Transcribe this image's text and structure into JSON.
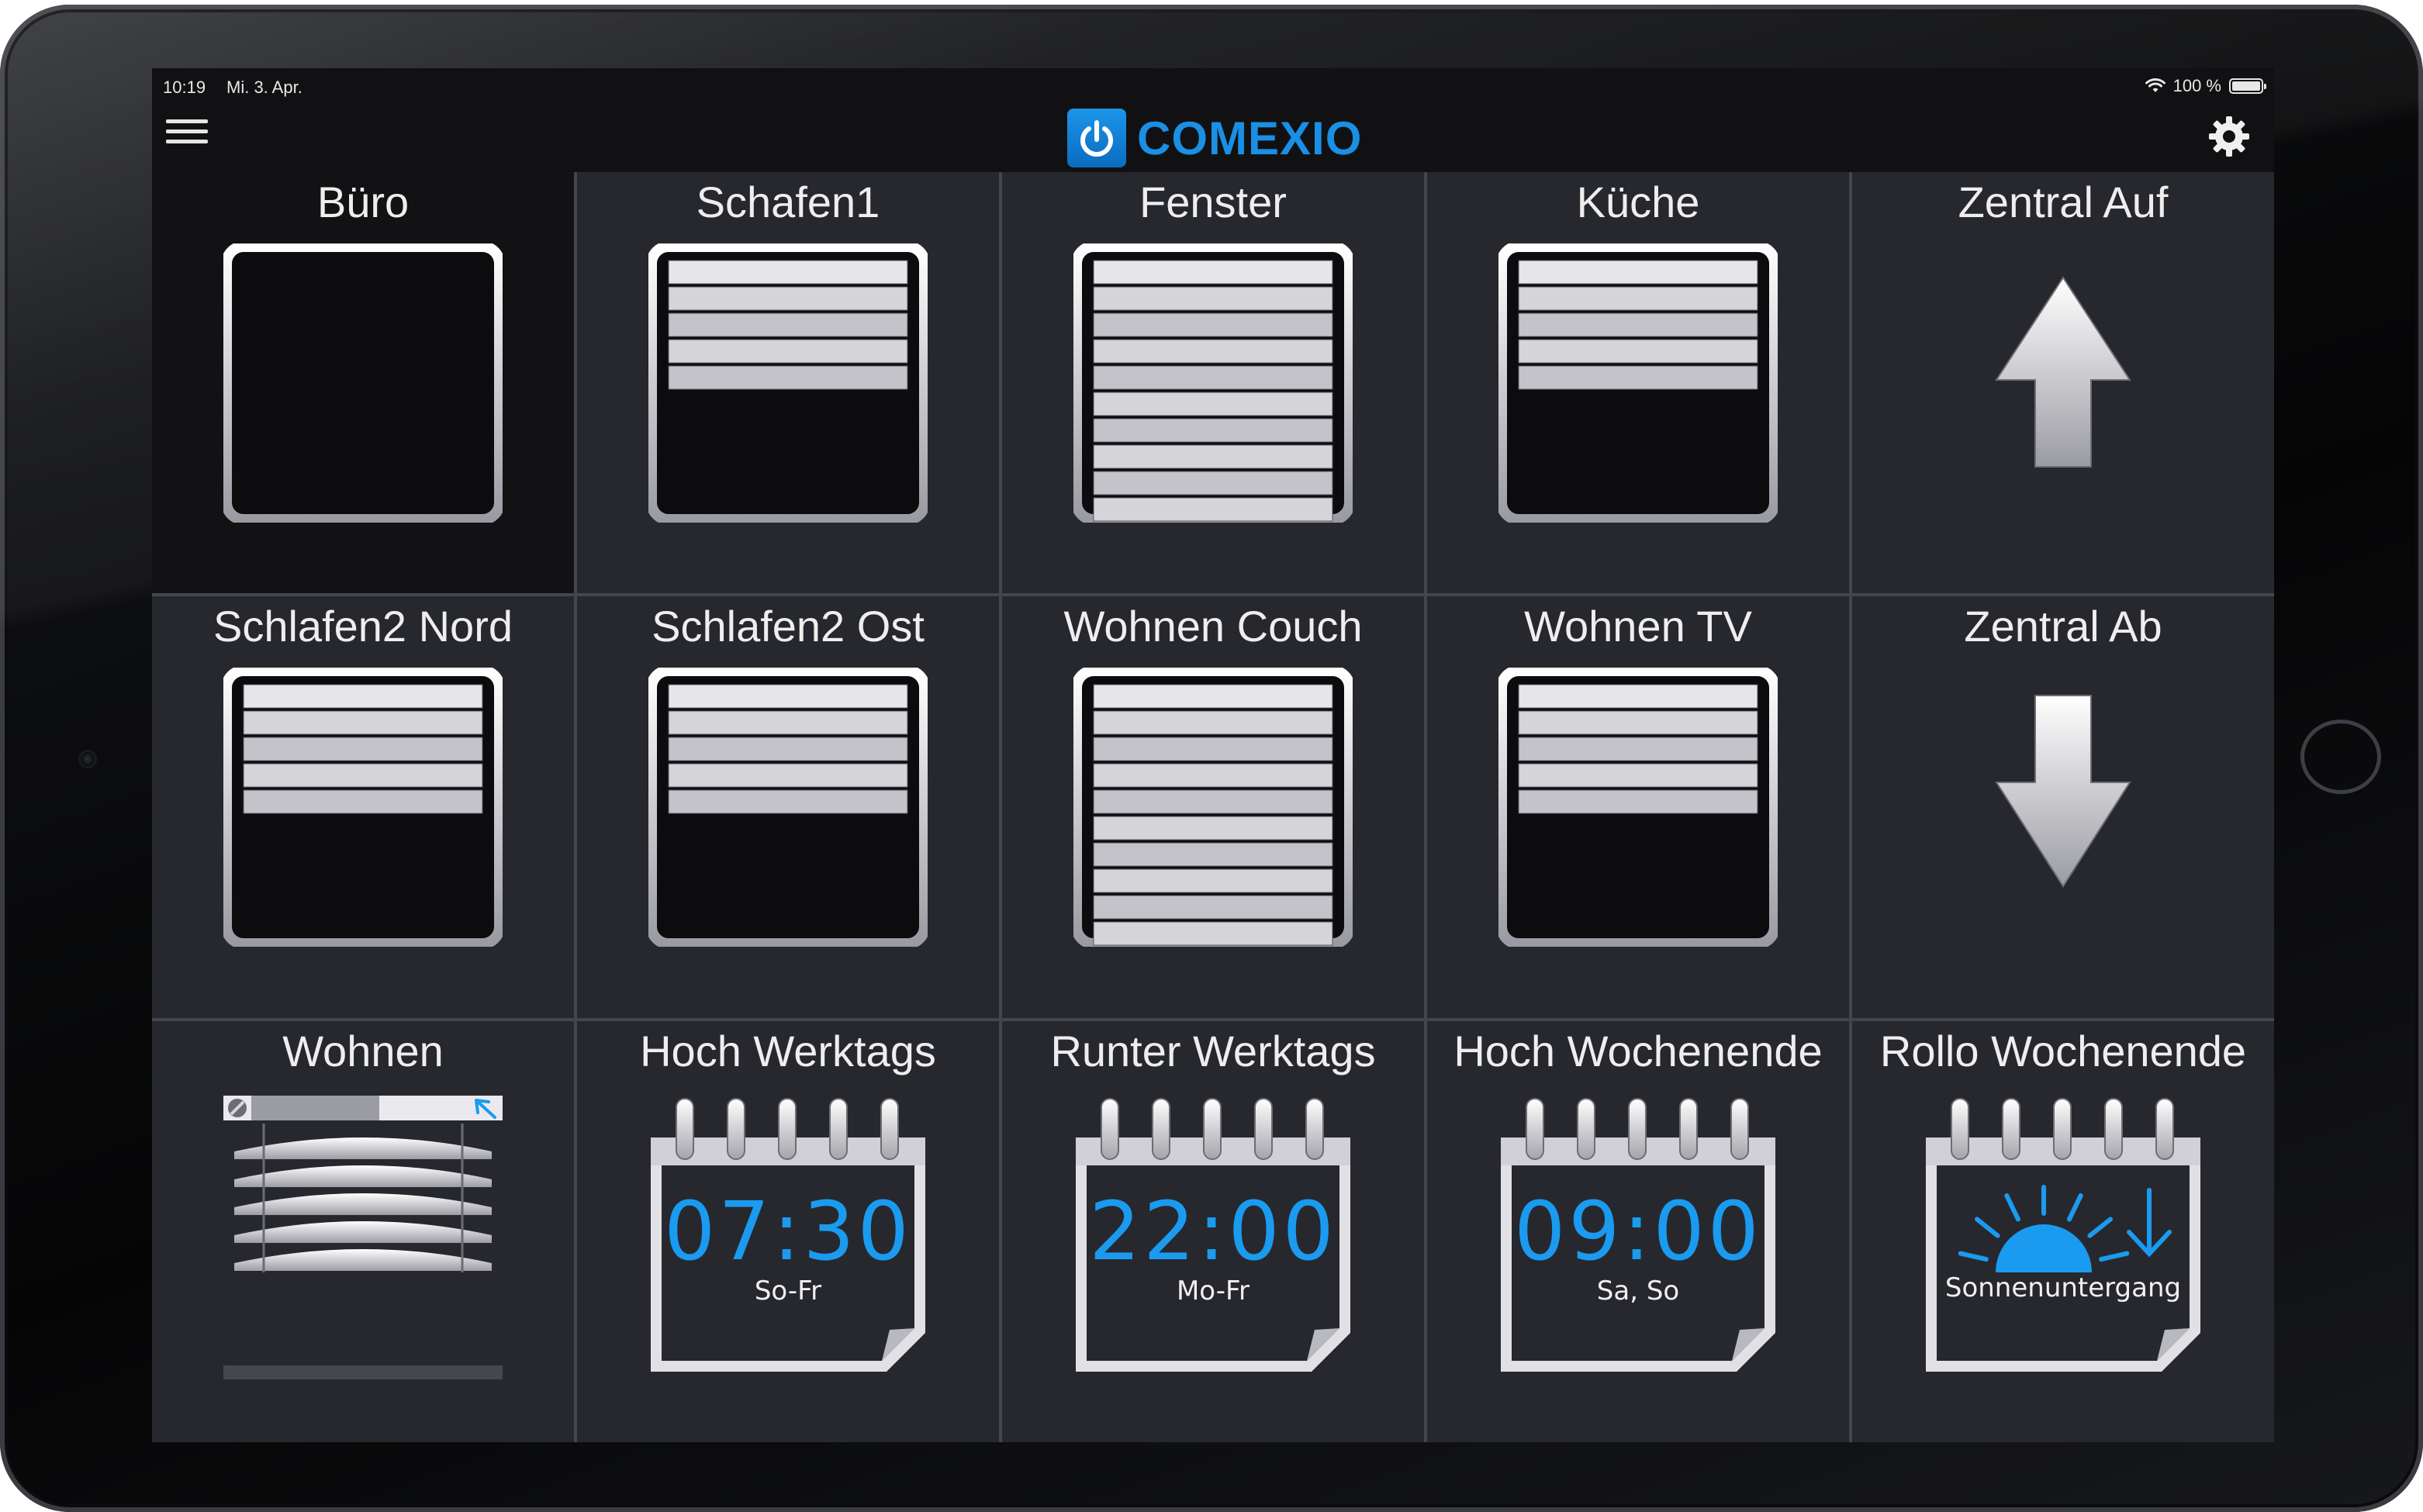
{
  "status": {
    "time": "10:19",
    "date": "Mi. 3. Apr.",
    "battery": "100 %",
    "battery_level": 1.0
  },
  "app": {
    "brand": "COMEXIO",
    "brand_color": "#1a8fe3",
    "accent": "#1a9bf0"
  },
  "tiles": [
    {
      "label": "Büro",
      "icon": "shutter-open-icon",
      "slats": 0,
      "active": true
    },
    {
      "label": "Schafen1",
      "icon": "shutter-partial-icon",
      "slats": 5
    },
    {
      "label": "Fenster",
      "icon": "shutter-closed-icon",
      "slats": 10
    },
    {
      "label": "Küche",
      "icon": "shutter-partial-icon",
      "slats": 5
    },
    {
      "label": "Zentral Auf",
      "icon": "arrow-up-icon"
    },
    {
      "label": "Schlafen2 Nord",
      "icon": "shutter-partial-icon",
      "slats": 5
    },
    {
      "label": "Schlafen2 Ost",
      "icon": "shutter-partial-icon",
      "slats": 5
    },
    {
      "label": "Wohnen Couch",
      "icon": "shutter-closed-icon",
      "slats": 10
    },
    {
      "label": "Wohnen TV",
      "icon": "shutter-partial-icon",
      "slats": 5
    },
    {
      "label": "Zentral Ab",
      "icon": "arrow-down-icon"
    },
    {
      "label": "Wohnen",
      "icon": "venetian-blind-icon",
      "slider_level": 0.55
    },
    {
      "label": "Hoch Werktags",
      "icon": "calendar-icon",
      "time": "07:30",
      "days": "So-Fr"
    },
    {
      "label": "Runter Werktags",
      "icon": "calendar-icon",
      "time": "22:00",
      "days": "Mo-Fr"
    },
    {
      "label": "Hoch Wochenende",
      "icon": "calendar-icon",
      "time": "09:00",
      "days": "Sa, So"
    },
    {
      "label": "Rollo Wochenende",
      "icon": "calendar-sunset-icon",
      "caption": "Sonnenuntergang"
    }
  ]
}
